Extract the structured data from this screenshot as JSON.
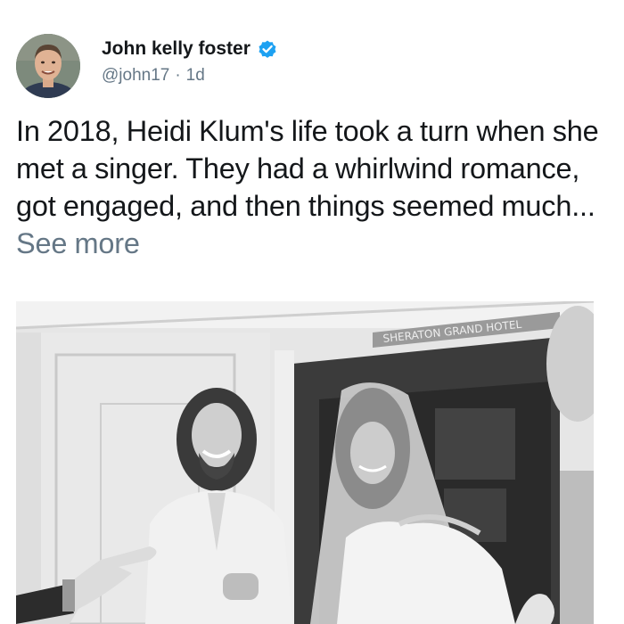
{
  "author": {
    "display_name": "John kelly foster",
    "handle": "@john17",
    "separator": "·",
    "time": "1d",
    "verified_icon": "verified-badge-icon"
  },
  "tweet": {
    "text": "In 2018, Heidi Klum's life took a turn when she met a singer. They had a whirlwind romance, got engaged, and then things seemed much...",
    "see_more_label": "See more"
  },
  "media": {
    "type": "photo",
    "style": "black-and-white",
    "sign_text": "SHERATON GRAND HOTEL"
  },
  "colors": {
    "text_primary": "#14171a",
    "text_secondary": "#657786",
    "verified_blue": "#1da1f2",
    "background": "#ffffff"
  }
}
